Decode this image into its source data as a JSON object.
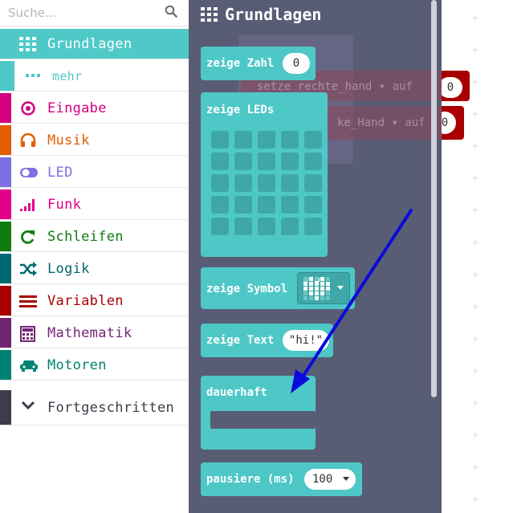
{
  "search": {
    "placeholder": "Suche..."
  },
  "categories": [
    {
      "label": "Grundlagen",
      "color": "#4fc8c8",
      "icon": "grid-icon",
      "selected": true
    },
    {
      "label": "mehr",
      "color": "#4fc8c8",
      "icon": "more-dots-icon",
      "sub": true
    },
    {
      "label": "Eingabe",
      "color": "#d4007f",
      "icon": "target-icon"
    },
    {
      "label": "Musik",
      "color": "#e35e00",
      "icon": "headphones-icon"
    },
    {
      "label": "LED",
      "color": "#7e6fe3",
      "icon": "toggle-icon"
    },
    {
      "label": "Funk",
      "color": "#e3008c",
      "icon": "signal-bars-icon"
    },
    {
      "label": "Schleifen",
      "color": "#107c10",
      "icon": "loop-arrow-icon"
    },
    {
      "label": "Logik",
      "color": "#006970",
      "icon": "shuffle-icon"
    },
    {
      "label": "Variablen",
      "color": "#a80000",
      "icon": "lines-icon"
    },
    {
      "label": "Mathematik",
      "color": "#712672",
      "icon": "calculator-icon"
    },
    {
      "label": "Motoren",
      "color": "#008272",
      "icon": "car-icon"
    },
    {
      "label": "Fortgeschritten",
      "color": "#3c3c4b",
      "icon": "chevron-down-icon"
    }
  ],
  "flyout": {
    "title": "Grundlagen",
    "blocks": {
      "show_number": {
        "label": "zeige Zahl",
        "value": "0"
      },
      "show_leds": {
        "label": "zeige LEDs"
      },
      "show_icon": {
        "label": "zeige Symbol"
      },
      "show_string": {
        "label": "zeige Text",
        "value": "\"hi!\""
      },
      "forever": {
        "label": "dauerhaft"
      },
      "pause": {
        "label": "pausiere (ms)",
        "value": "100"
      }
    }
  },
  "workspace": {
    "set_right": {
      "text": "setze  rechte_hand",
      "to": "auf",
      "value": "0"
    },
    "set_left": {
      "text": "ke_Hand",
      "to": "auf",
      "value": "0"
    }
  },
  "colors": {
    "flyout_bg": "#585d75",
    "block": "#4ec7c7",
    "arrow": "#0a0adc",
    "variable_block": "#a80000"
  }
}
